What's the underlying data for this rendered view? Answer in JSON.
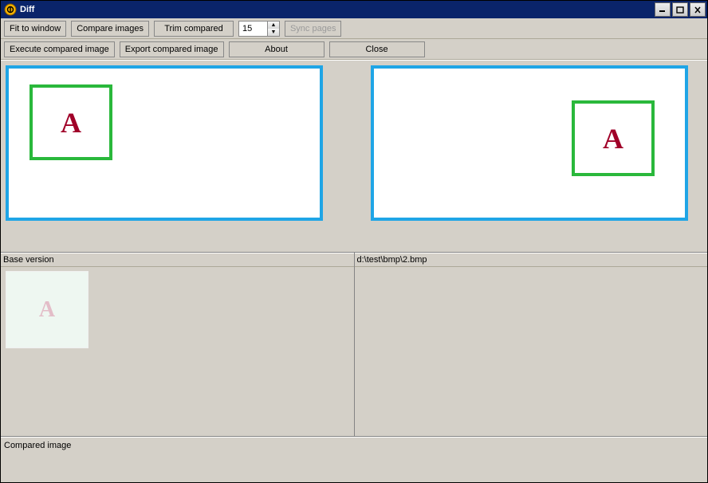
{
  "window": {
    "title": "Diff"
  },
  "toolbar1": {
    "fit_to_window": "Fit to window",
    "compare_images": "Compare images",
    "trim_compared": "Trim compared",
    "trim_value": "15",
    "sync_pages": "Sync pages"
  },
  "toolbar2": {
    "execute": "Execute compared image",
    "export": "Export compared image",
    "about": "About",
    "close": "Close"
  },
  "labels": {
    "base_version": "Base version",
    "right_path": "d:\\test\\bmp\\2.bmp",
    "compared_image": "Compared image"
  },
  "glyph": {
    "A": "A"
  }
}
